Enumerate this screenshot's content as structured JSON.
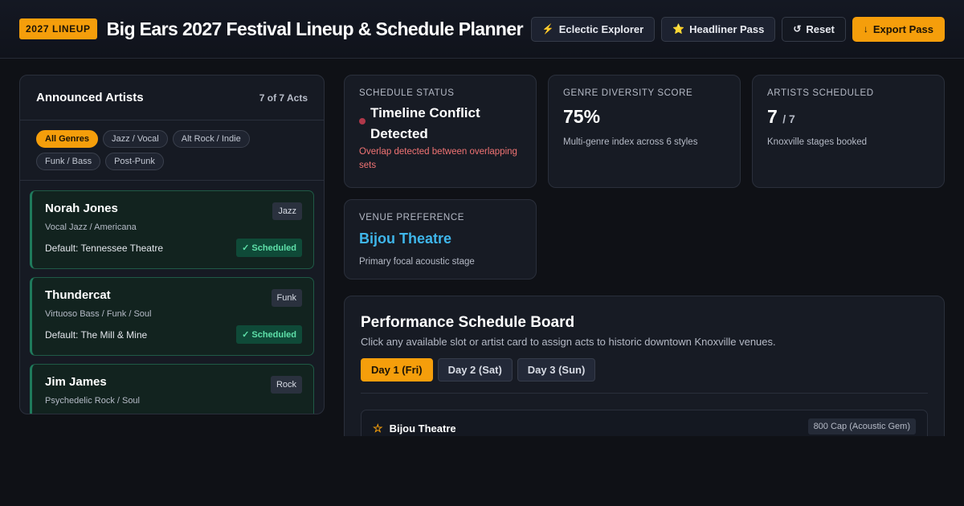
{
  "header": {
    "badge": "2027 LINEUP",
    "title": "Big Ears 2027 Festival Lineup & Schedule Planner",
    "buttons": [
      {
        "icon": "lightning-icon",
        "glyph": "⚡",
        "label": "Eclectic Explorer"
      },
      {
        "icon": "star-icon",
        "glyph": "⭐",
        "label": "Headliner Pass"
      },
      {
        "icon": "reset-icon",
        "glyph": "↺",
        "label": "Reset"
      },
      {
        "icon": "download-icon",
        "glyph": "↓",
        "label": "Export Pass"
      }
    ]
  },
  "artists_panel": {
    "title": "Announced Artists",
    "count": "7 of 7 Acts",
    "filters": [
      "All Genres",
      "Jazz / Vocal",
      "Alt Rock / Indie",
      "Funk / Bass",
      "Post-Punk"
    ],
    "active_filter": "All Genres",
    "artists": [
      {
        "name": "Norah Jones",
        "tag": "Jazz",
        "style": "Vocal Jazz / Americana",
        "venue": "Default: Tennessee Theatre",
        "status": "✓ Scheduled"
      },
      {
        "name": "Thundercat",
        "tag": "Funk",
        "style": "Virtuoso Bass / Funk / Soul",
        "venue": "Default: The Mill & Mine",
        "status": "✓ Scheduled"
      },
      {
        "name": "Jim James",
        "tag": "Rock",
        "style": "Psychedelic Rock / Soul",
        "venue": "",
        "status": ""
      }
    ]
  },
  "stats": {
    "schedule_status": {
      "label": "Schedule Status",
      "value": "Timeline Conflict Detected",
      "note": "Overlap detected between overlapping sets",
      "indicator_color": "#b0384a"
    },
    "genre_diversity": {
      "label": "Genre Diversity Score",
      "value": "75%",
      "note": "Multi-genre index across 6 styles"
    },
    "artists_scheduled": {
      "label": "Artists Scheduled",
      "value": "7",
      "total": "/ 7",
      "note": "Knoxville stages booked"
    },
    "venue_preference": {
      "label": "Venue Preference",
      "value": "Bijou Theatre",
      "note": "Primary focal acoustic stage"
    }
  },
  "board": {
    "title": "Performance Schedule Board",
    "subtitle": "Click any available slot or artist card to assign acts to historic downtown Knoxville venues.",
    "days": [
      "Day 1 (Fri)",
      "Day 2 (Sat)",
      "Day 3 (Sun)"
    ],
    "active_day": "Day 1 (Fri)",
    "venues": [
      {
        "icon": "star-outline-icon",
        "name": "Bijou Theatre",
        "capacity": "800 Cap (Acoustic Gem)"
      }
    ]
  },
  "colors": {
    "accent": "#f59e0b",
    "scheduled_green": "#5ee0a9",
    "venue_blue": "#3fb6ea",
    "conflict_red": "#f07373"
  }
}
